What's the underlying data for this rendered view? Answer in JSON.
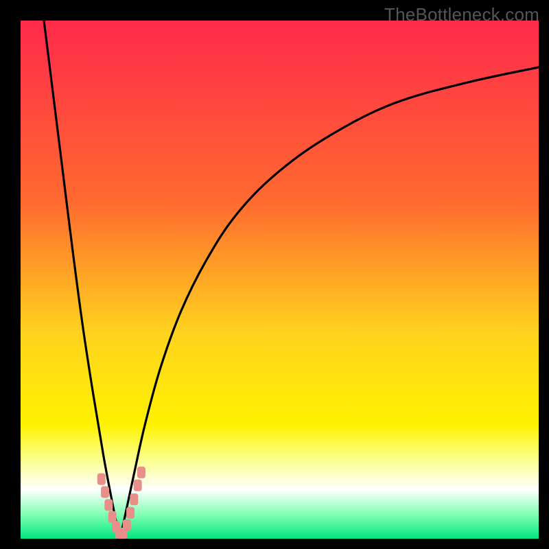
{
  "watermark": "TheBottleneck.com",
  "chart_data": {
    "type": "line",
    "title": "",
    "xlabel": "",
    "ylabel": "",
    "xlim": [
      0,
      100
    ],
    "ylim": [
      0,
      100
    ],
    "gradient_stops": [
      {
        "offset": 0.0,
        "color": "#ff2a4b"
      },
      {
        "offset": 0.35,
        "color": "#ff6a2f"
      },
      {
        "offset": 0.6,
        "color": "#ffd21f"
      },
      {
        "offset": 0.78,
        "color": "#fff200"
      },
      {
        "offset": 0.84,
        "color": "#fbff7f"
      },
      {
        "offset": 0.905,
        "color": "#ffffff"
      },
      {
        "offset": 0.955,
        "color": "#7dffb0"
      },
      {
        "offset": 1.0,
        "color": "#00e57f"
      }
    ],
    "series": [
      {
        "name": "left-branch",
        "x": [
          4.5,
          6,
          8,
          10,
          12,
          14,
          16,
          17.5,
          18.5,
          19.2
        ],
        "y": [
          100,
          88,
          72,
          56,
          41,
          28,
          16,
          8,
          3,
          0
        ]
      },
      {
        "name": "right-branch",
        "x": [
          19.2,
          20.5,
          22,
          24,
          27,
          31,
          36,
          42,
          50,
          60,
          72,
          86,
          100
        ],
        "y": [
          0,
          6,
          13,
          22,
          33,
          44,
          54,
          63,
          71,
          78,
          84,
          88,
          91
        ]
      }
    ],
    "markers": [
      {
        "x": 15.6,
        "y": 11.5
      },
      {
        "x": 16.3,
        "y": 9.0
      },
      {
        "x": 17.0,
        "y": 6.5
      },
      {
        "x": 17.7,
        "y": 4.2
      },
      {
        "x": 18.4,
        "y": 2.3
      },
      {
        "x": 19.1,
        "y": 1.0
      },
      {
        "x": 19.8,
        "y": 1.0
      },
      {
        "x": 20.5,
        "y": 2.6
      },
      {
        "x": 21.2,
        "y": 5.0
      },
      {
        "x": 21.9,
        "y": 7.6
      },
      {
        "x": 22.6,
        "y": 10.3
      },
      {
        "x": 23.3,
        "y": 12.8
      }
    ],
    "marker_style": {
      "fill": "#e88f8a",
      "rx": 3.5,
      "w": 12,
      "h": 17
    },
    "line_style": {
      "stroke": "#000000",
      "width": 3.2
    }
  }
}
